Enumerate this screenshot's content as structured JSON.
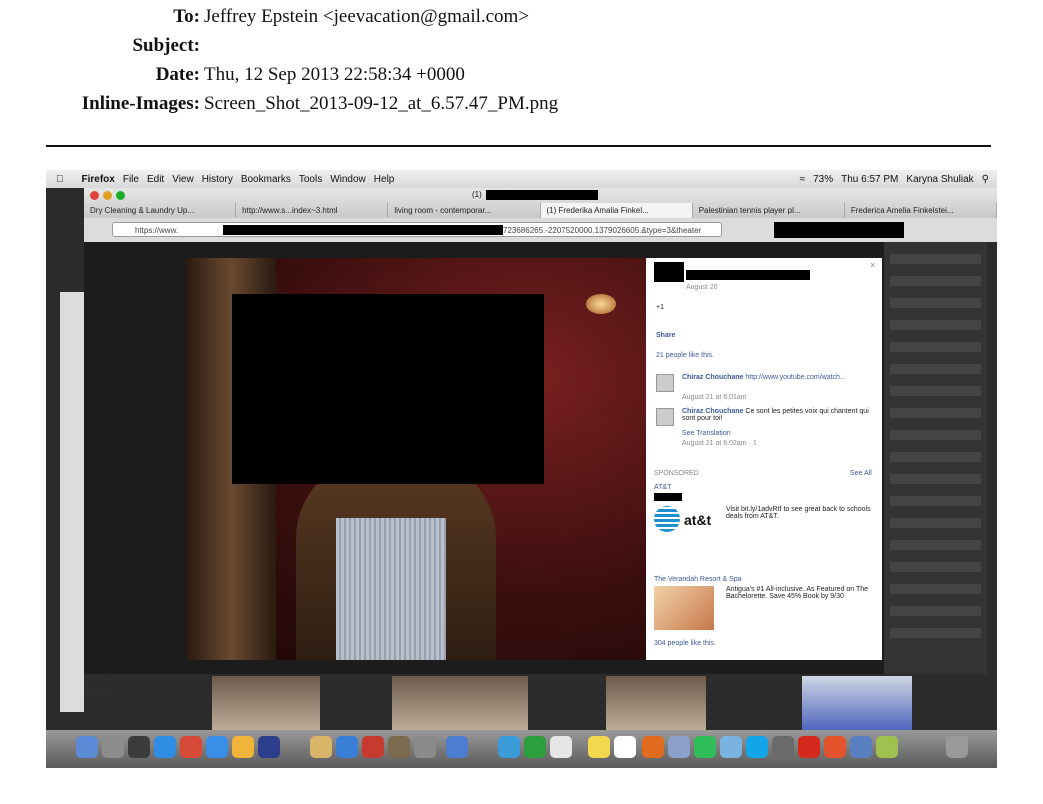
{
  "email": {
    "to_label": "To:",
    "to_value": "Jeffrey Epstein <jeevacation@gmail.com>",
    "subject_label": "Subject:",
    "subject_value": "",
    "date_label": "Date:",
    "date_value": "Thu, 12 Sep 2013 22:58:34 +0000",
    "images_label": "Inline-Images:",
    "images_value": "Screen_Shot_2013-09-12_at_6.57.47_PM.png"
  },
  "screenshot": {
    "menubar": {
      "app": "Firefox",
      "items": [
        "File",
        "Edit",
        "View",
        "History",
        "Bookmarks",
        "Tools",
        "Window",
        "Help"
      ],
      "battery": "73%",
      "clock": "Thu 6:57 PM",
      "user": "Karyna Shuliak"
    },
    "window_title": "(1)",
    "tabs": [
      "Dry Cleaning & Laundry Up...",
      "http://www.s...index~3.html",
      "living room - contemporar...",
      "(1) Frederika Amalia Finkel...",
      "Palestinian tennis player pl...",
      "Frederica Amelia Finkelstei..."
    ],
    "url_prefix": "https://www.",
    "url_tail": "723686265.-2207520000.1379026605.&type=3&theater",
    "panel": {
      "date": "August 20",
      "plus_one": "+1",
      "share": "Share",
      "likes": "21 people like this.",
      "comments": [
        {
          "author": "Chiraz Chouchane",
          "text": "http://www.youtube.com/watch...",
          "meta": "August 21 at 6:01am"
        },
        {
          "author": "Chiraz Chouchane",
          "text": "Ce sont les petites voix qui chantent qui sont pour toi!",
          "translate": "See Translation",
          "meta": "August 21 at 6:02am · 1"
        }
      ],
      "sponsored": "SPONSORED",
      "see_all": "See All",
      "att_name": "AT&T",
      "att_logo": "at&t",
      "att_text": "Visit bit.ly/1advRtf to see great back to schools deals from AT&T.",
      "ver_name": "The Verandah Resort & Spa",
      "ver_text": "Antigua's #1 All-inclusive. As Featured on The Bachelorette. Save 45% Book by 9/30",
      "ver_likes": "304 people like this."
    },
    "finder_items": [
      "styles",
      "iphone"
    ]
  }
}
